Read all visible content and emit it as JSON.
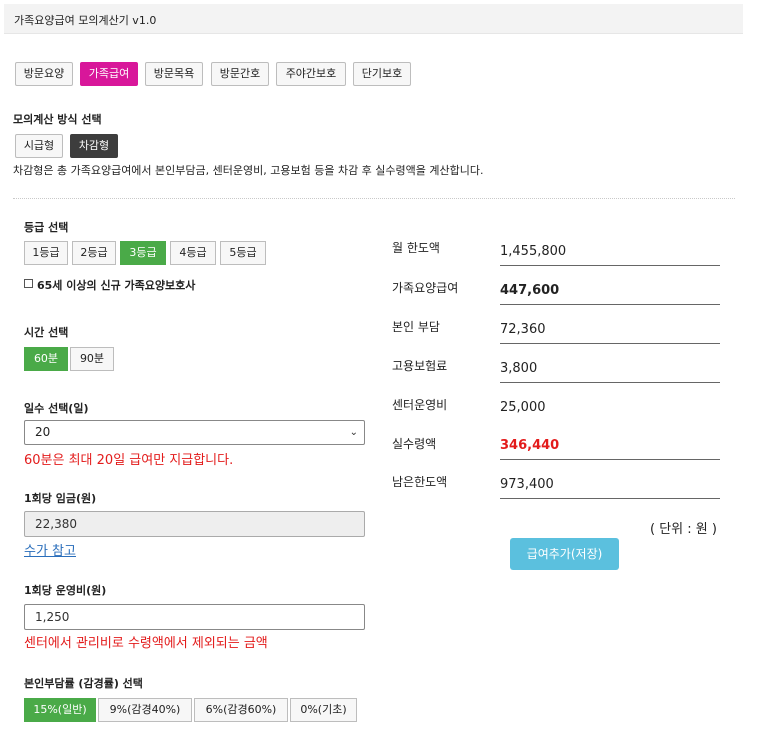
{
  "app": {
    "title": "가족요양급여 모의계산기 v1.0"
  },
  "service_tabs": [
    "방문요양",
    "가족급여",
    "방문목욕",
    "방문간호",
    "주야간보호",
    "단기보호"
  ],
  "method": {
    "label": "모의계산 방식 선택",
    "options": [
      "시급형",
      "차감형"
    ],
    "description": "차감형은 총 가족요양급여에서 본인부담금, 센터운영비, 고용보험 등을 차감 후 실수령액을 계산합니다."
  },
  "grade": {
    "label": "등급 선택",
    "options": [
      "1등급",
      "2등급",
      "3등급",
      "4등급",
      "5등급"
    ],
    "checkbox_label": "65세 이상의 신규 가족요양보호사"
  },
  "time": {
    "label": "시간 선택",
    "options": [
      "60분",
      "90분"
    ]
  },
  "days": {
    "label": "일수 선택(일)",
    "selected": "20",
    "warning": "60분은 최대 20일 급여만 지급합니다."
  },
  "wage": {
    "label": "1회당 임금(원)",
    "value": "22,380",
    "link": "수가 참고"
  },
  "opcost": {
    "label": "1회당 운영비(원)",
    "value": "1,250",
    "warning": "센터에서 관리비로 수령액에서 제외되는 금액"
  },
  "copay": {
    "label": "본인부담률 (감경률) 선택",
    "options": [
      "15%(일반)",
      "9%(감경40%)",
      "6%(감경60%)",
      "0%(기초)"
    ]
  },
  "results": {
    "monthly_limit_label": "월 한도액",
    "monthly_limit": "1,455,800",
    "family_care_label": "가족요양급여",
    "family_care": "447,600",
    "copay_label": "본인 부담",
    "copay": "72,360",
    "insurance_label": "고용보험료",
    "insurance": "3,800",
    "center_fee_label": "센터운영비",
    "center_fee": "25,000",
    "net_label": "실수령액",
    "net": "346,440",
    "remaining_label": "남은한도액",
    "remaining": "973,400",
    "unit": "( 단위 : 원 )",
    "save_button": "급여추가(저장)"
  },
  "colors": {
    "active_tab": "#d8179a",
    "active_option": "#4aaa48",
    "dark_option": "#3d3d3d",
    "warning": "#e31b1b",
    "save_button": "#5bc0de",
    "link": "#2a6ebb"
  }
}
